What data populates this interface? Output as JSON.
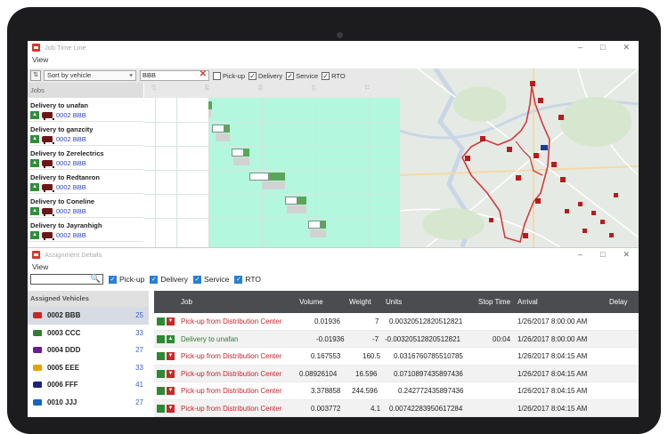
{
  "timeline": {
    "title": "Job Time Line",
    "menu": "View",
    "sort_select": "Sort by vehicle",
    "filter_value": "BBB",
    "checks": [
      {
        "label": "Pick-up",
        "checked": false
      },
      {
        "label": "Delivery",
        "checked": true
      },
      {
        "label": "Service",
        "checked": true
      },
      {
        "label": "RTO",
        "checked": true
      }
    ],
    "jobs_header": "Jobs",
    "ruler_ticks": [
      "07",
      "08",
      "09",
      "10",
      "11"
    ],
    "jobs": [
      {
        "title": "Delivery to unafan",
        "vehicle": "0002 BBB"
      },
      {
        "title": "Delivery to ganzcity",
        "vehicle": "0002 BBB"
      },
      {
        "title": "Delivery to Zerelectrics",
        "vehicle": "0002 BBB"
      },
      {
        "title": "Delivery to Redtanron",
        "vehicle": "0002 BBB"
      },
      {
        "title": "Delivery to Coneline",
        "vehicle": "0002 BBB"
      },
      {
        "title": "Delivery to Jayranhigh",
        "vehicle": "0002 BBB"
      }
    ]
  },
  "details": {
    "title": "Assignment Details",
    "menu": "View",
    "filters": [
      "Pick-up",
      "Delivery",
      "Service",
      "RTO"
    ],
    "vehicles_header": "Assigned Vehicles",
    "vehicles": [
      {
        "name": "0002 BBB",
        "count": "25",
        "color": "#c62828"
      },
      {
        "name": "0003 CCC",
        "count": "33",
        "color": "#2e7d32"
      },
      {
        "name": "0004 DDD",
        "count": "27",
        "color": "#6a1b9a"
      },
      {
        "name": "0005 EEE",
        "count": "33",
        "color": "#e6a100"
      },
      {
        "name": "0006 FFF",
        "count": "41",
        "color": "#1a237e"
      },
      {
        "name": "0010 JJJ",
        "count": "27",
        "color": "#1565c0"
      }
    ],
    "columns": [
      "Job",
      "Volume",
      "Weight",
      "Units",
      "Stop Time",
      "Arrival",
      "Delay"
    ],
    "rows": [
      {
        "job": "Pick-up from Distribution Center",
        "volume": "0.01936",
        "weight": "7",
        "units": "0.00320512820512821",
        "stop": "",
        "arrival": "1/26/2017 8:00:00 AM",
        "type": "pickup"
      },
      {
        "job": "Delivery to unafan",
        "volume": "-0.01936",
        "weight": "-7",
        "units": "-0.00320512820512821",
        "stop": "00:04",
        "arrival": "1/26/2017 8:00:00 AM",
        "type": "delivery"
      },
      {
        "job": "Pick-up from Distribution Center",
        "volume": "0.167553",
        "weight": "160.5",
        "units": "0.0316760785510785",
        "stop": "",
        "arrival": "1/26/2017 8:04:15 AM",
        "type": "pickup"
      },
      {
        "job": "Pick-up from Distribution Center",
        "volume": "0.08926104",
        "weight": "16.596",
        "units": "0.0710897435897436",
        "stop": "",
        "arrival": "1/26/2017 8:04:15 AM",
        "type": "pickup"
      },
      {
        "job": "Pick-up from Distribution Center",
        "volume": "3.378858",
        "weight": "244.596",
        "units": "0.242772435897436",
        "stop": "",
        "arrival": "1/26/2017 8:04:15 AM",
        "type": "pickup"
      },
      {
        "job": "Pick-up from Distribution Center",
        "volume": "0.003772",
        "weight": "4.1",
        "units": "0.00742283950617284",
        "stop": "",
        "arrival": "1/26/2017 8:04:15 AM",
        "type": "pickup"
      }
    ]
  }
}
